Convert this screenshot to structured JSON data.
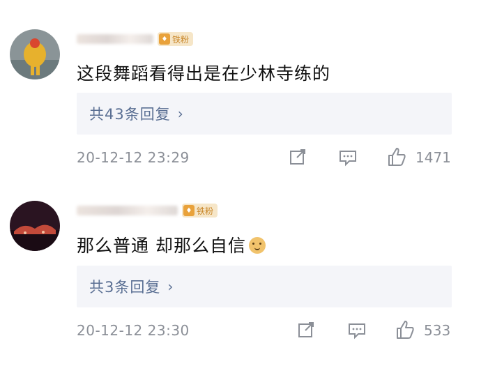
{
  "comments": [
    {
      "badge_label": "铁粉",
      "text": "这段舞蹈看得出是在少林寺练的",
      "reply_label": "共43条回复",
      "reply_chevron": "›",
      "timestamp": "20-12-12 23:29",
      "like_count": "1471",
      "avatar_colors": {
        "bg": "#7d8b8f",
        "figure": "#e7b12d"
      }
    },
    {
      "badge_label": "铁粉",
      "text": "那么普通 却那么自信",
      "reply_label": "共3条回复",
      "reply_chevron": "›",
      "timestamp": "20-12-12 23:30",
      "like_count": "533",
      "avatar_colors": {
        "bg": "#24121e",
        "figure": "#c24a3a"
      }
    }
  ],
  "icons": {
    "share": "share-icon",
    "comment": "comment-icon",
    "like": "thumbs-up-icon",
    "emoji": "doge-emoji"
  },
  "colors": {
    "reply_link": "#5a6f93",
    "meta_text": "#8b8f97",
    "badge_bg": "#f6e6c8",
    "badge_text": "#c9872a"
  }
}
